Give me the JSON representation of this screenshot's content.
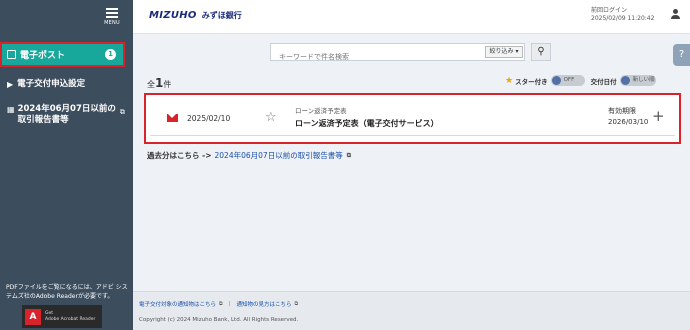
{
  "sidebar": {
    "menu_label": "MENU",
    "items": [
      {
        "label": "電子ポスト",
        "badge": "1",
        "active": true
      },
      {
        "label": "電子交付申込設定"
      },
      {
        "label_line1": "2024年06月07日以前の",
        "label_line2": "取引報告書等"
      }
    ],
    "note": "PDFファイルをご覧になるには、アドビ システムズ社のAdobe Readerが必要です。",
    "acrobat": {
      "line1": "Get",
      "line2": "Adobe Acrobat Reader"
    }
  },
  "header": {
    "brand_en": "MIZUHO",
    "brand_ja": "みずほ銀行",
    "last_login_label": "前回ログイン",
    "last_login_time": "2025/02/09 11:20:42"
  },
  "search": {
    "placeholder": "キーワードで件名検索",
    "refine_label": "絞り込み"
  },
  "help_label": "?",
  "list": {
    "count_prefix": "全",
    "count": "1",
    "count_suffix": "件",
    "filters": {
      "star_label": "スター付き",
      "toggle_off": "OFF",
      "date_label": "交付日付",
      "order_label": "新しい順"
    },
    "items": [
      {
        "date": "2025/02/10",
        "category": "ローン返済予定表",
        "title": "ローン返済予定表（電子交付サービス）",
        "expiry_label": "有効期限",
        "expiry_date": "2026/03/10"
      }
    ]
  },
  "past_link": {
    "prefix": "過去分はこちら ->",
    "link": "2024年06月07日以前の取引報告書等"
  },
  "footer": {
    "link1": "電子交付対象の通知物はこちら",
    "link2": "通知物の見方はこちら",
    "copyright": "Copyright (c) 2024 Mizuho Bank, Ltd. All Rights Reserved."
  }
}
